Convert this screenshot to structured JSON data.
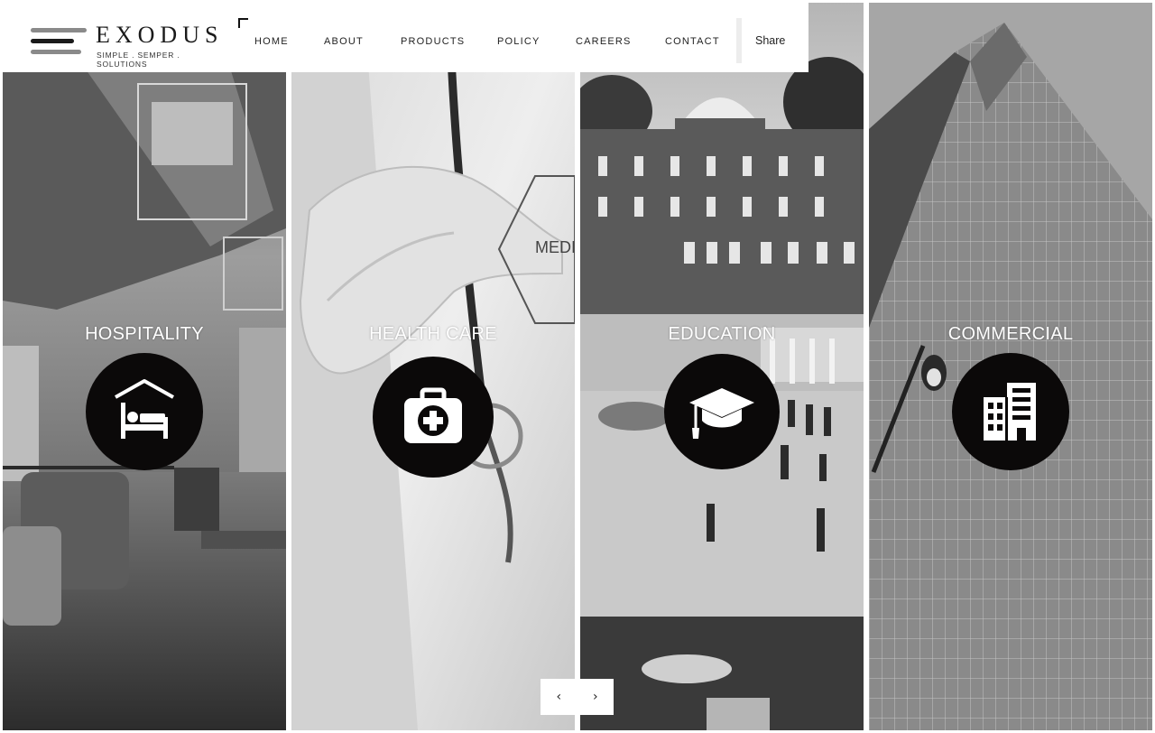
{
  "header": {
    "brand": "EXODUS",
    "tagline": "SIMPLE . SEMPER . SOLUTIONS",
    "nav": [
      "HOME",
      "ABOUT",
      "PRODUCTS",
      "POLICY",
      "CAREERS",
      "CONTACT"
    ],
    "share_label": "Share"
  },
  "panels": [
    {
      "title": "HOSPITALITY",
      "icon": "bed-icon"
    },
    {
      "title": "HEALTH CARE",
      "icon": "medical-kit-icon",
      "sign_text": "MEDIC"
    },
    {
      "title": "EDUCATION",
      "icon": "graduation-cap-icon"
    },
    {
      "title": "COMMERCIAL",
      "icon": "building-icon"
    }
  ],
  "carousel": {
    "prev_label": "‹",
    "next_label": "›"
  }
}
